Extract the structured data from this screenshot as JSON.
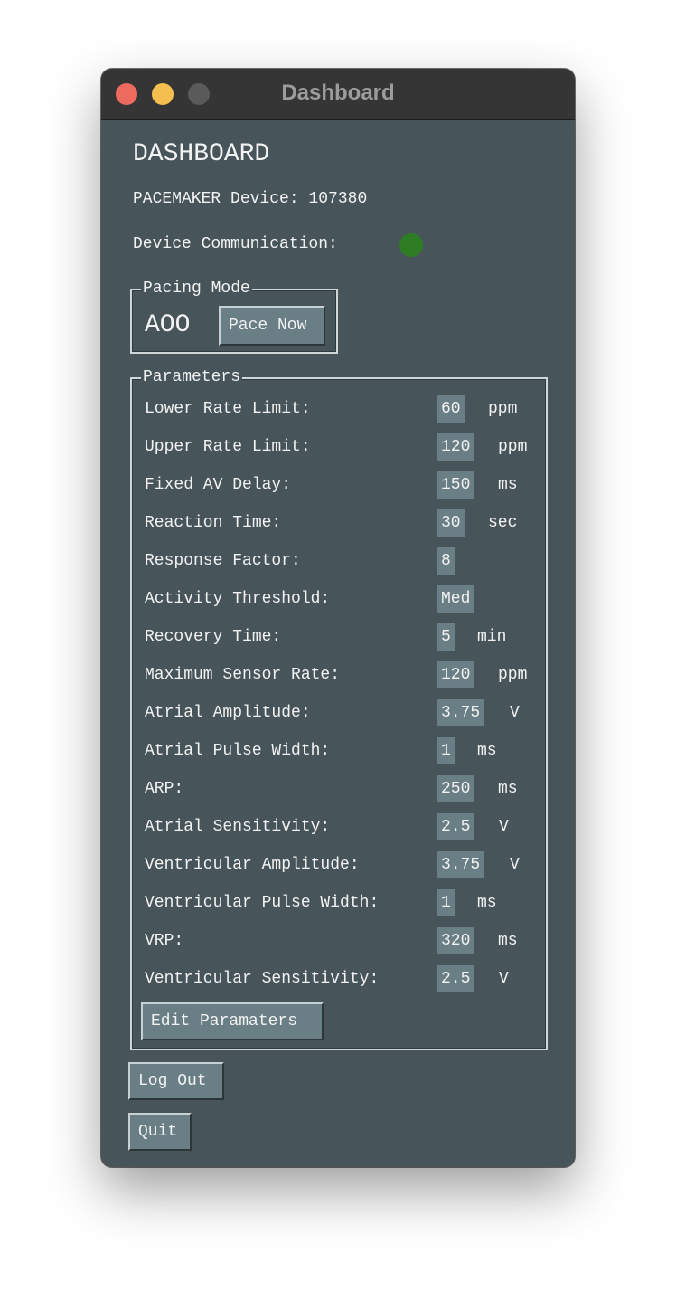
{
  "window": {
    "title": "Dashboard"
  },
  "dashboard": {
    "heading": "DASHBOARD",
    "device_label": "PACEMAKER Device: 107380",
    "communication_label": "Device Communication:",
    "communication_status_color": "#2e7d24"
  },
  "pacing_mode": {
    "legend": "Pacing Mode",
    "mode": "AOO",
    "pace_button": "Pace Now"
  },
  "parameters": {
    "legend": "Parameters",
    "items": [
      {
        "label": "Lower Rate Limit:",
        "value": "60",
        "unit": "ppm"
      },
      {
        "label": "Upper Rate Limit:",
        "value": "120",
        "unit": "ppm"
      },
      {
        "label": "Fixed AV Delay:",
        "value": "150",
        "unit": "ms"
      },
      {
        "label": "Reaction Time:",
        "value": "30",
        "unit": "sec"
      },
      {
        "label": "Response Factor:",
        "value": "8",
        "unit": ""
      },
      {
        "label": "Activity Threshold:",
        "value": "Med",
        "unit": ""
      },
      {
        "label": "Recovery Time:",
        "value": "5",
        "unit": "min"
      },
      {
        "label": "Maximum Sensor Rate:",
        "value": "120",
        "unit": "ppm"
      },
      {
        "label": "Atrial Amplitude:",
        "value": "3.75",
        "unit": "V"
      },
      {
        "label": "Atrial Pulse Width:",
        "value": "1",
        "unit": "ms"
      },
      {
        "label": "ARP:",
        "value": "250",
        "unit": "ms"
      },
      {
        "label": "Atrial Sensitivity:",
        "value": "2.5",
        "unit": "V"
      },
      {
        "label": "Ventricular Amplitude:",
        "value": "3.75",
        "unit": "V"
      },
      {
        "label": "Ventricular Pulse Width:",
        "value": "1",
        "unit": "ms"
      },
      {
        "label": "VRP:",
        "value": "320",
        "unit": "ms"
      },
      {
        "label": "Ventricular Sensitivity:",
        "value": "2.5",
        "unit": "V"
      }
    ],
    "edit_button": "Edit Paramaters"
  },
  "actions": {
    "logout_button": "Log Out",
    "quit_button": "Quit"
  }
}
